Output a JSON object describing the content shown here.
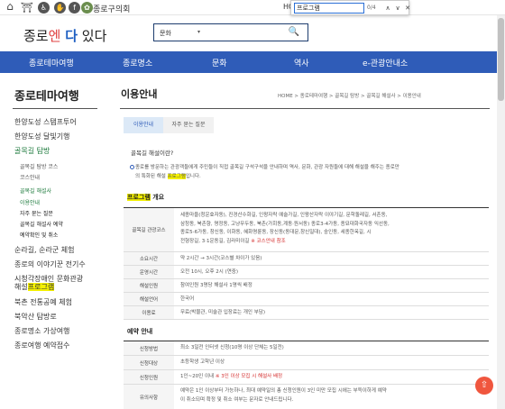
{
  "topbar": {
    "home_icon": "⌂",
    "council_label": "종로구의회",
    "hq_label": "HC"
  },
  "findbar": {
    "query": "프로그램",
    "count": "0/4",
    "up": "∧",
    "down": "∨",
    "close": "✕"
  },
  "header": {
    "logo_part1": "종로",
    "logo_part2": "엔",
    "logo_part3": "다",
    "logo_part4": "있다",
    "search_scope": "문화",
    "search_arrow": "▾",
    "search_icon": "🔍"
  },
  "nav": {
    "items": [
      "종로테마여행",
      "종로명소",
      "문화",
      "역사",
      "e-관광안내소"
    ]
  },
  "sidebar": {
    "title": "종로테마여행",
    "items": [
      "한양도성 스탬프투어",
      "한양도성 달빛기행",
      "골목길 탐방"
    ],
    "sub_items": [
      "골목길 탐방 코스",
      "코스안내",
      "골목길 해설사"
    ],
    "sub2_items": [
      "이용안내",
      "자주 묻는 질문",
      "골목길 해설사 예약",
      "예약확인 및 취소"
    ],
    "items2": [
      "순라길, 순라군 체험",
      "종로의 이야기꾼 전기수",
      "시청각장애인 문화관광",
      "해설",
      "프로그램",
      "북촌 전통공예 체험",
      "북악산 탐방로",
      "종로명소 가상여행",
      "종로여행 예약접수"
    ]
  },
  "content": {
    "title": "이용안내",
    "breadcrumb": "HOME > 종로테마여행 > 골목길 탐방 > 골목길 해설사 > 이용안내",
    "tabs": [
      "이용안내",
      "자주 묻는 질문"
    ],
    "question": "골목길 해설이란?",
    "intro_line1": "종로를 방문하는 관광객들에게 주민들이 직접 골목길 구석구석을 안내하며 역사, 문화, 관광 자원들에 대해 해설을 해주는 종로만",
    "intro_line2_pre": "의 특화된 해설 ",
    "intro_line2_hl": "프로그램",
    "intro_line2_post": "입니다.",
    "overview_hl": "프로그램",
    "overview_post": " 개요",
    "rows": [
      {
        "label": "골목길 관광코스",
        "value_lines": [
          "세종마을(청운효자동), 진경산수화길, 인왕자락 예술가길, 인왕산자락 이야기길, 문학돌레길, 서촌동,",
          "삼청동, 북촌향, 명정동, 고냥무두동, 북촌(가회동,계동·원서동) 종로3-4가동, 종묘대화국자동 익선동,",
          "종로5-6가동, 창신동, 이화동, 혜화명륜동, 장신동(동대문,창신일대), 숭인동, 세종한옥길, 시",
          "전형장길, 3·1운동길, 김라미이길"
        ],
        "value_red": "※ 코스안내 참조"
      },
      {
        "label": "소요시간",
        "value_lines": [
          "약 2시간 → 3시간(코스별 차이가 있음)"
        ]
      },
      {
        "label": "운영시간",
        "value_lines": [
          "오전 10시, 오후 2시 (연중)"
        ]
      },
      {
        "label": "해설인원",
        "value_lines": [
          "참여인원 3명당 해설사 1명씩 배정"
        ]
      },
      {
        "label": "해설언어",
        "value_lines": [
          "한국어"
        ]
      },
      {
        "label": "이용료",
        "value_lines": [
          "무료(박물관, 미술관 입장료는 개인 부담)"
        ]
      }
    ],
    "reserve_title": "예약 안내",
    "reserve_rows": [
      {
        "label": "신청방법",
        "value": "최소 3일전 인터넷 신청(10명 이상 단체는 5일전)"
      },
      {
        "label": "신청대상",
        "value": "초등학생 고학년 이상"
      },
      {
        "label": "신청인원",
        "value_pre": "1인~20인 이내 ",
        "value_red": "※ 3인 이상 모집 시 해설사 배정"
      },
      {
        "label": "유의사항",
        "value_lines": [
          "예약은 1인 이상부터 가능하나, 최대 예약일의 총 신청인원이 3인 미만 모집 시에는 부득이하게 예약",
          "이 취소되며 확정 및 취소 여부는 문자로 안내드립니다."
        ]
      }
    ]
  },
  "top_button_icon": "⇧"
}
